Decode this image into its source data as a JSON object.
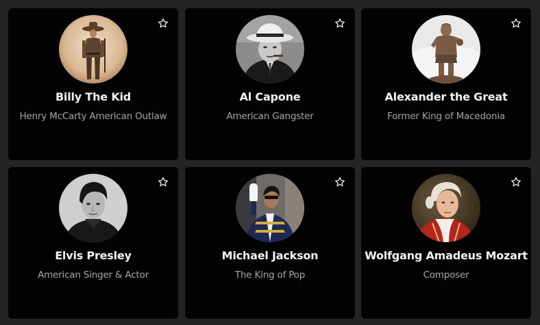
{
  "cards": [
    {
      "name": "Billy The Kid",
      "description": "Henry McCarty American Outlaw",
      "avatar_icon": "billy-the-kid-portrait"
    },
    {
      "name": "Al Capone",
      "description": "American Gangster",
      "avatar_icon": "al-capone-portrait"
    },
    {
      "name": "Alexander the Great",
      "description": "Former King of Macedonia",
      "avatar_icon": "alexander-statue-portrait"
    },
    {
      "name": "Elvis Presley",
      "description": "American Singer & Actor",
      "avatar_icon": "elvis-presley-portrait"
    },
    {
      "name": "Michael Jackson",
      "description": "The King of Pop",
      "avatar_icon": "michael-jackson-portrait"
    },
    {
      "name": "Wolfgang Amadeus Mozart",
      "description": "Composer",
      "avatar_icon": "mozart-portrait"
    }
  ],
  "favorite_icon": "star-outline-icon",
  "colors": {
    "page_background": "#222426",
    "card_background": "#030303",
    "name_text": "#f2f2f2",
    "description_text": "#a6a6a6"
  }
}
